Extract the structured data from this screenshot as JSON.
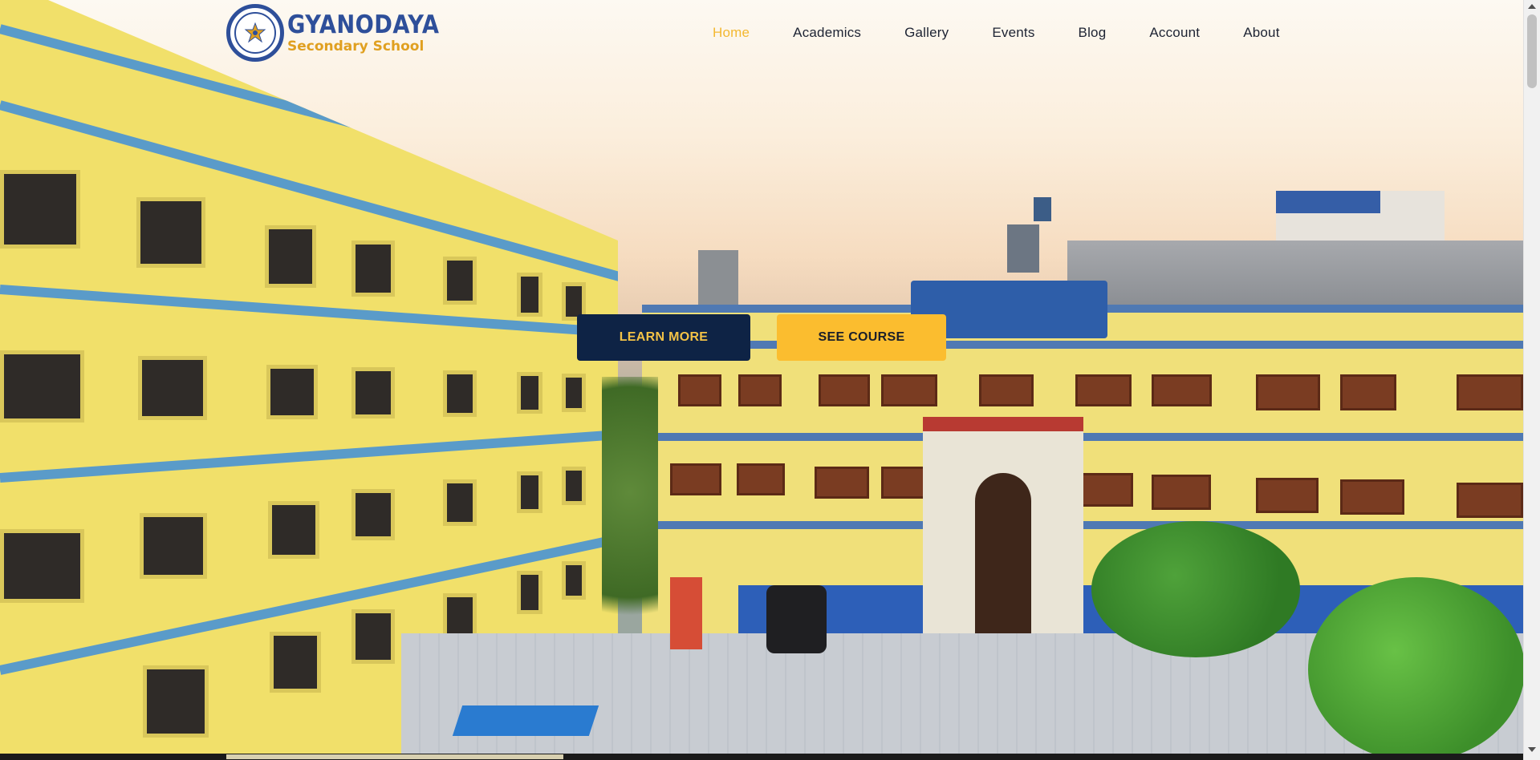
{
  "brand": {
    "title": "GYANODAYA",
    "subtitle": "Secondary School"
  },
  "nav": {
    "items": [
      {
        "label": "Home",
        "active": true
      },
      {
        "label": "Academics",
        "active": false
      },
      {
        "label": "Gallery",
        "active": false
      },
      {
        "label": "Events",
        "active": false
      },
      {
        "label": "Blog",
        "active": false
      },
      {
        "label": "Account",
        "active": false
      },
      {
        "label": "About",
        "active": false
      }
    ]
  },
  "hero": {
    "learn_more_label": "LEARN MORE",
    "see_course_label": "SEE COURSE"
  },
  "colors": {
    "accent": "#fbbd2f",
    "primary_dark": "#0e2345",
    "brand_blue": "#2e4f9a",
    "nav_active": "#f3b831"
  },
  "icons": {
    "logo": "school-seal-icon",
    "scroll_up": "chevron-up-icon",
    "scroll_down": "chevron-down-icon"
  }
}
